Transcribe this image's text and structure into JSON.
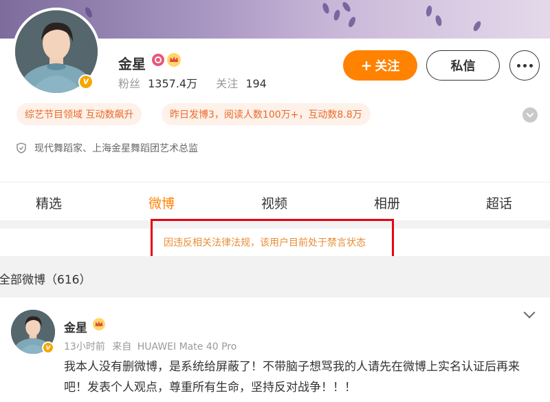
{
  "profile": {
    "name": "金星",
    "fans_label": "粉丝",
    "fans_count": "1357.4万",
    "following_label": "关注",
    "following_count": "194",
    "follow_button": "关注",
    "follow_plus": "+",
    "message_button": "私信",
    "tags": [
      "综艺节目领域 互动数飙升",
      "昨日发博3，阅读人数100万+，互动数8.8万"
    ],
    "description": "现代舞蹈家、上海金星舞蹈团艺术总监",
    "verified_badge": "v"
  },
  "tabs": [
    {
      "label": "精选",
      "active": false
    },
    {
      "label": "微博",
      "active": true
    },
    {
      "label": "视频",
      "active": false
    },
    {
      "label": "相册",
      "active": false
    },
    {
      "label": "超话",
      "active": false
    }
  ],
  "notice": "因违反相关法律法规，该用户目前处于禁言状态",
  "all_posts_label": "全部微博（616）",
  "post": {
    "author": "金星",
    "time": "13小时前",
    "source_prefix": "来自",
    "source": "HUAWEI Mate 40 Pro",
    "text": "我本人没有删微博，是系统给屏蔽了！不带脑子想骂我的人请先在微博上实名认证后再来吧！发表个人观点，尊重所有生命，坚持反对战争！！！"
  },
  "colors": {
    "accent": "#ff8200",
    "notice_text": "#e88c33",
    "highlight_box": "#e60012",
    "tag_bg": "#fdf1e9",
    "tag_text": "#e86b2b"
  },
  "icons": [
    "lens-icon",
    "crown-icon",
    "verified-v-icon",
    "more-icon",
    "expand-chevron-icon",
    "shield-icon",
    "chevron-down-icon"
  ]
}
